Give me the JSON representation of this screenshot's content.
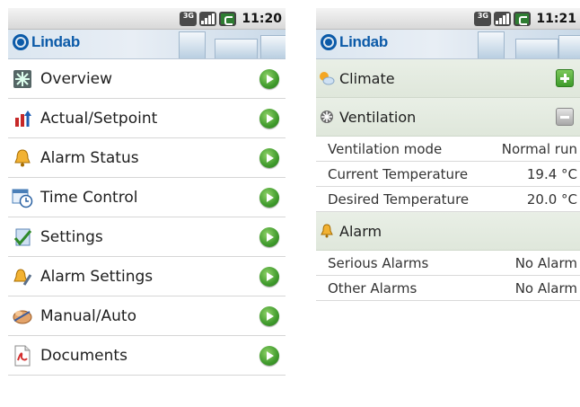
{
  "status_left": {
    "time": "11:20",
    "network": "3G"
  },
  "status_right": {
    "time": "11:21",
    "network": "3G"
  },
  "brand": {
    "logo_text": "Lindab"
  },
  "menu": [
    {
      "label": "Overview",
      "icon": "fan-grid-icon"
    },
    {
      "label": "Actual/Setpoint",
      "icon": "thermometer-arrows-icon"
    },
    {
      "label": "Alarm Status",
      "icon": "bell-icon"
    },
    {
      "label": "Time Control",
      "icon": "calendar-clock-icon"
    },
    {
      "label": "Settings",
      "icon": "checklist-icon"
    },
    {
      "label": "Alarm Settings",
      "icon": "bell-edit-icon"
    },
    {
      "label": "Manual/Auto",
      "icon": "hand-icon"
    },
    {
      "label": "Documents",
      "icon": "pdf-document-icon"
    }
  ],
  "sections": {
    "climate": {
      "label": "Climate"
    },
    "ventilation": {
      "label": "Ventilation",
      "rows": [
        {
          "key": "Ventilation mode",
          "value": "Normal run"
        },
        {
          "key": "Current Temperature",
          "value": "19.4 °C"
        },
        {
          "key": "Desired Temperature",
          "value": "20.0 °C"
        }
      ]
    },
    "alarm": {
      "label": "Alarm",
      "rows": [
        {
          "key": "Serious Alarms",
          "value": "No Alarm"
        },
        {
          "key": "Other Alarms",
          "value": "No Alarm"
        }
      ]
    }
  },
  "colors": {
    "brand_blue": "#0b5aa8",
    "go_green": "#3f9a2c",
    "section_bg": "#e4ebe1"
  }
}
